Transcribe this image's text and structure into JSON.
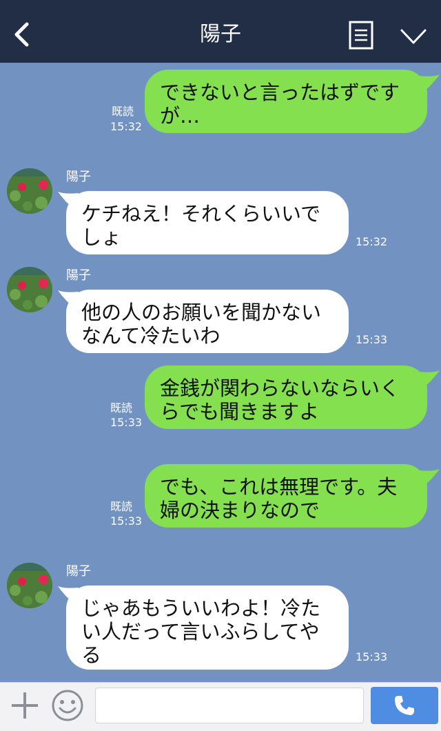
{
  "header": {
    "title": "陽子"
  },
  "messages": [
    {
      "type": "out",
      "text": "できないと言ったはずですが…",
      "read": "既読",
      "time": "15:32"
    },
    {
      "type": "in",
      "sender": "陽子",
      "text": "ケチねえ！それくらいいでしょ",
      "time": "15:32"
    },
    {
      "type": "in",
      "sender": "陽子",
      "text": "他の人のお願いを聞かないなんて冷たいわ",
      "time": "15:33"
    },
    {
      "type": "out",
      "text": "金銭が関わらないならいくらでも聞きますよ",
      "read": "既読",
      "time": "15:33"
    },
    {
      "type": "out",
      "text": "でも、これは無理です。夫婦の決まりなので",
      "read": "既読",
      "time": "15:33"
    },
    {
      "type": "in",
      "sender": "陽子",
      "text": "じゃあもういいわよ！冷たい人だって言いふらしてやる",
      "time": "15:33"
    }
  ],
  "composer": {
    "value": "",
    "placeholder": ""
  },
  "colors": {
    "header_bg": "#222d46",
    "chat_bg": "#7293c1",
    "outgoing_bubble": "#84e04e",
    "incoming_bubble": "#ffffff",
    "call_button": "#4f8de3"
  },
  "icons": [
    "back-icon",
    "menu-icon",
    "chevron-down-icon",
    "plus-icon",
    "smile-icon",
    "phone-icon"
  ]
}
